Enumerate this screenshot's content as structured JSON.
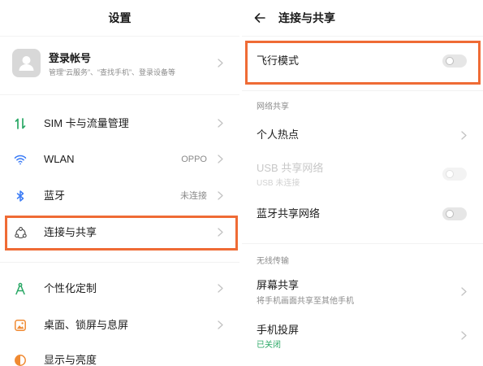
{
  "colors": {
    "highlight": "#ef6b35",
    "status_green": "#2aa866",
    "icon_green": "#2aa866",
    "icon_blue": "#3b7cf6",
    "icon_orange": "#f08a32"
  },
  "left": {
    "title": "设置",
    "account": {
      "title": "登录帐号",
      "subtitle": "管理“云服务”、“查找手机”、登录设备等",
      "icon": "avatar-icon",
      "trailing_icon": "chevron-right-icon"
    },
    "items": [
      {
        "label": "SIM 卡与流量管理",
        "icon": "sim-data-icon",
        "trailing_icon": "chevron-right-icon"
      },
      {
        "label": "WLAN",
        "value": "OPPO",
        "icon": "wifi-icon",
        "trailing_icon": "chevron-right-icon"
      },
      {
        "label": "蓝牙",
        "value": "未连接",
        "icon": "bluetooth-icon",
        "trailing_icon": "chevron-right-icon"
      },
      {
        "label": "连接与共享",
        "icon": "connection-share-icon",
        "trailing_icon": "chevron-right-icon",
        "highlighted": true
      },
      {
        "label": "个性化定制",
        "icon": "personalization-icon",
        "trailing_icon": "chevron-right-icon"
      },
      {
        "label": "桌面、锁屏与息屏",
        "icon": "home-lockscreen-icon",
        "trailing_icon": "chevron-right-icon"
      },
      {
        "label": "显示与亮度",
        "icon": "display-brightness-icon"
      }
    ]
  },
  "right": {
    "back_icon": "back-arrow-icon",
    "title": "连接与共享",
    "airplane_mode": {
      "label": "飞行模式",
      "on": false,
      "highlighted": true
    },
    "sections": [
      {
        "header": "网络共享",
        "items": [
          {
            "label": "个人热点",
            "trailing_icon": "chevron-right-icon"
          },
          {
            "label": "USB 共享网络",
            "subtitle": "USB 未连接",
            "on": false,
            "disabled": true
          },
          {
            "label": "蓝牙共享网络",
            "on": false
          }
        ]
      },
      {
        "header": "无线传输",
        "items": [
          {
            "label": "屏幕共享",
            "subtitle": "将手机画面共享至其他手机",
            "trailing_icon": "chevron-right-icon"
          },
          {
            "label": "手机投屏",
            "subtitle": "已关闭",
            "subtitle_color": "#2aa866",
            "trailing_icon": "chevron-right-icon"
          }
        ]
      }
    ]
  }
}
